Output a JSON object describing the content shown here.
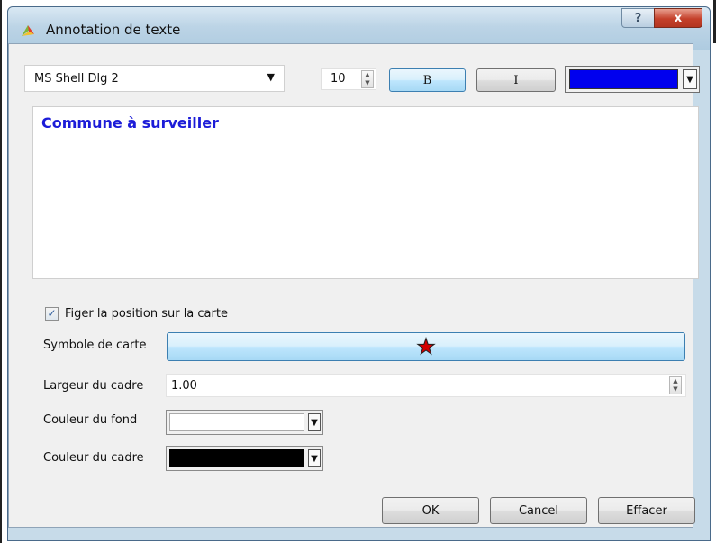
{
  "window": {
    "title": "Annotation de texte"
  },
  "titlebar": {
    "help_label": "?",
    "close_label": "x"
  },
  "toolbar": {
    "font_value": "MS Shell Dlg 2",
    "size_value": "10",
    "bold_label": "B",
    "italic_label": "I",
    "text_color": "#0000ee"
  },
  "editor": {
    "text": "Commune à surveiller",
    "text_color": "#1c1cd8"
  },
  "options": {
    "fix_position_label": "Figer la position sur la carte",
    "fix_position_checked": true,
    "map_symbol_label": "Symbole de carte",
    "map_symbol_icon": "red-star-icon",
    "frame_width_label": "Largeur du cadre",
    "frame_width_value": "1.00",
    "background_color_label": "Couleur du fond",
    "background_color": "#ffffff",
    "frame_color_label": "Couleur du cadre",
    "frame_color": "#000000"
  },
  "buttons": {
    "ok": "OK",
    "cancel": "Cancel",
    "clear": "Effacer"
  }
}
